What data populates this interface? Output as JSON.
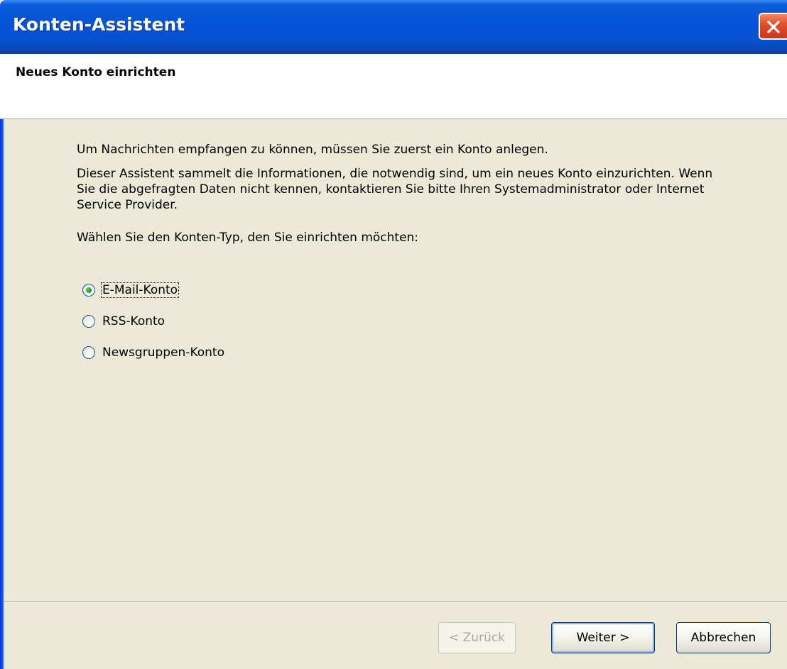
{
  "window": {
    "title": "Konten-Assistent",
    "close_label": "×"
  },
  "header": {
    "title": "Neues Konto einrichten"
  },
  "content": {
    "paragraph1": "Um Nachrichten empfangen zu können, müssen Sie zuerst ein Konto anlegen.",
    "paragraph2": "Dieser Assistent sammelt die Informationen, die notwendig sind, um ein neues Konto einzurichten. Wenn Sie die abgefragten Daten nicht kennen, kontaktieren Sie bitte Ihren Systemadministrator oder Internet Service Provider.",
    "paragraph3": "Wählen Sie den Konten-Typ, den Sie einrichten möchten:"
  },
  "account_types": [
    {
      "label": "E-Mail-Konto",
      "selected": true
    },
    {
      "label": "RSS-Konto",
      "selected": false
    },
    {
      "label": "Newsgruppen-Konto",
      "selected": false
    }
  ],
  "buttons": {
    "back": "< Zurück",
    "next": "Weiter >",
    "cancel": "Abbrechen"
  },
  "colors": {
    "titlebar": "#0553d6",
    "background": "#ece9d8",
    "radio_selected": "#21a121"
  }
}
